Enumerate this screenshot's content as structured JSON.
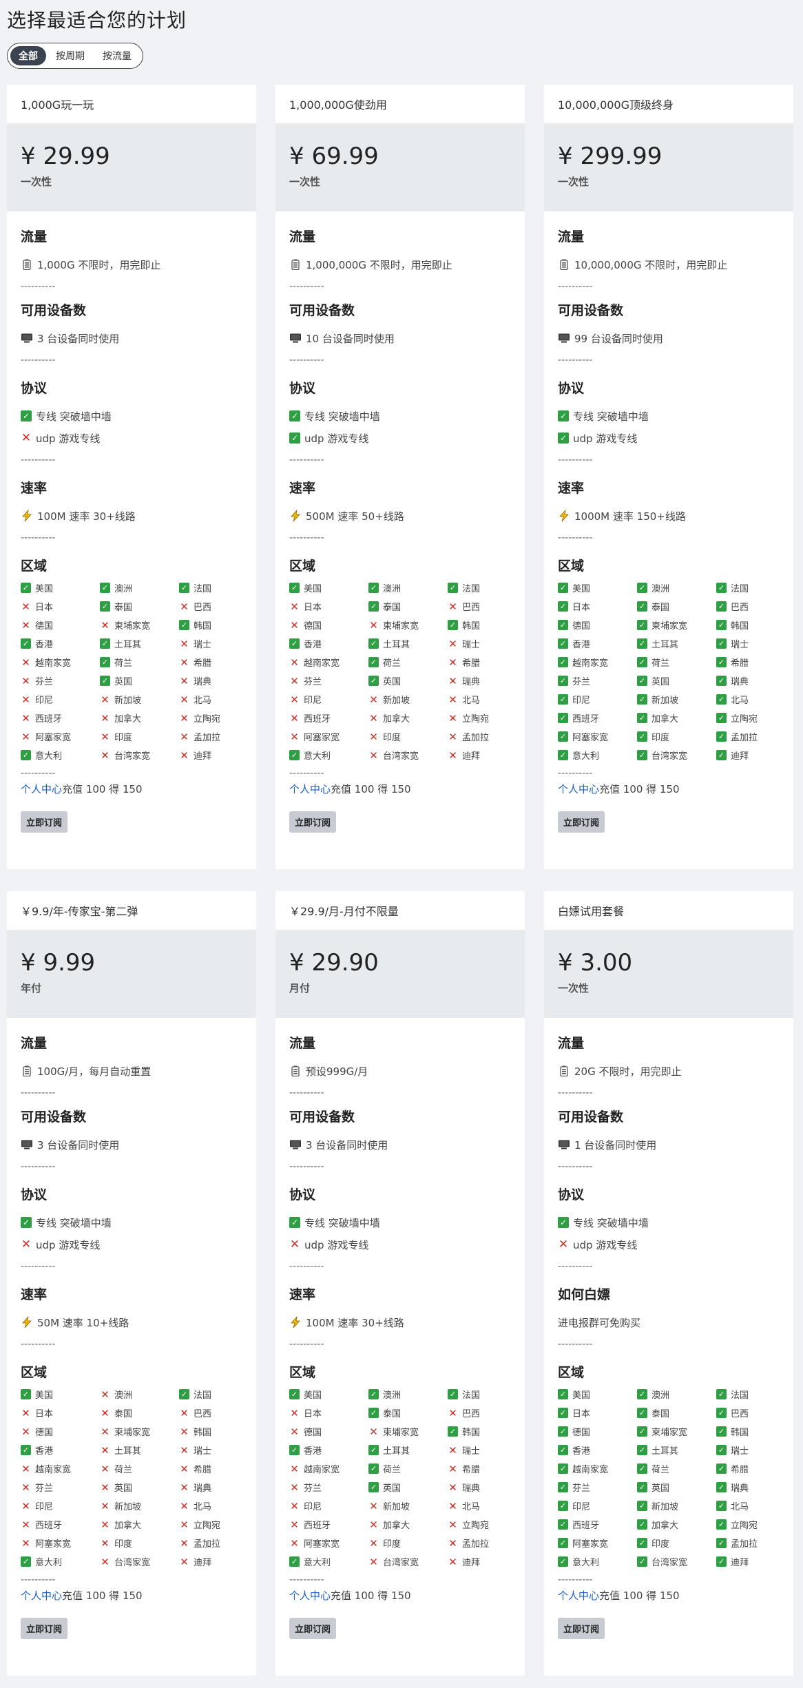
{
  "title": "选择最适合您的计划",
  "filters": [
    "全部",
    "按周期",
    "按流量"
  ],
  "active_filter": 0,
  "labels": {
    "traffic": "流量",
    "devices": "可用设备数",
    "protocol": "协议",
    "speed": "速率",
    "regions": "区域",
    "separator": "----------",
    "promo_link": "个人中心",
    "promo_text": "充值 100 得 150",
    "subscribe": "立即订阅",
    "proto_1": "专线 突破墙中墙",
    "proto_2": "udp 游戏专线"
  },
  "region_names": [
    "美国",
    "澳洲",
    "法国",
    "日本",
    "泰国",
    "巴西",
    "德国",
    "柬埔家宽",
    "韩国",
    "香港",
    "土耳其",
    "瑞士",
    "越南家宽",
    "荷兰",
    "希腊",
    "芬兰",
    "英国",
    "瑞典",
    "印尼",
    "新加坡",
    "北马",
    "西班牙",
    "加拿大",
    "立陶宛",
    "阿塞家宽",
    "印度",
    "孟加拉",
    "意大利",
    "台湾家宽",
    "迪拜"
  ],
  "plans": [
    {
      "name": "1,000G玩一玩",
      "price": "¥ 29.99",
      "period": "一次性",
      "traffic": "1,000G 不限时，用完即止",
      "devices": "3 台设备同时使用",
      "proto": [
        true,
        false
      ],
      "speed": "100M 速率 30+线路",
      "regions": [
        1,
        1,
        1,
        0,
        1,
        0,
        0,
        0,
        1,
        1,
        1,
        0,
        0,
        1,
        0,
        0,
        1,
        0,
        0,
        0,
        0,
        0,
        0,
        0,
        0,
        0,
        0,
        1,
        0,
        0
      ]
    },
    {
      "name": "1,000,000G使劲用",
      "price": "¥ 69.99",
      "period": "一次性",
      "traffic": "1,000,000G 不限时，用完即止",
      "devices": "10 台设备同时使用",
      "proto": [
        true,
        true
      ],
      "speed": "500M 速率 50+线路",
      "regions": [
        1,
        1,
        1,
        0,
        1,
        0,
        0,
        0,
        1,
        1,
        1,
        0,
        0,
        1,
        0,
        0,
        1,
        0,
        0,
        0,
        0,
        0,
        0,
        0,
        0,
        0,
        0,
        1,
        0,
        0
      ]
    },
    {
      "name": "10,000,000G顶级终身",
      "price": "¥ 299.99",
      "period": "一次性",
      "traffic": "10,000,000G 不限时，用完即止",
      "devices": "99 台设备同时使用",
      "proto": [
        true,
        true
      ],
      "speed": "1000M 速率 150+线路",
      "regions": [
        1,
        1,
        1,
        1,
        1,
        1,
        1,
        1,
        1,
        1,
        1,
        1,
        1,
        1,
        1,
        1,
        1,
        1,
        1,
        1,
        1,
        1,
        1,
        1,
        1,
        1,
        1,
        1,
        1,
        1
      ]
    },
    {
      "name": "￥9.9/年-传家宝-第二弹",
      "price": "¥ 9.99",
      "period": "年付",
      "traffic": "100G/月，每月自动重置",
      "devices": "3 台设备同时使用",
      "proto": [
        true,
        false
      ],
      "speed": "50M 速率 10+线路",
      "regions": [
        1,
        0,
        1,
        0,
        0,
        0,
        0,
        0,
        0,
        1,
        0,
        0,
        0,
        0,
        0,
        0,
        0,
        0,
        0,
        0,
        0,
        0,
        0,
        0,
        0,
        0,
        0,
        1,
        0,
        0
      ]
    },
    {
      "name": "￥29.9/月-月付不限量",
      "price": "¥ 29.90",
      "period": "月付",
      "traffic": "预设999G/月",
      "devices": "3 台设备同时使用",
      "proto": [
        true,
        false
      ],
      "speed": "100M 速率 30+线路",
      "regions": [
        1,
        1,
        1,
        0,
        1,
        0,
        0,
        0,
        1,
        1,
        1,
        0,
        0,
        1,
        0,
        0,
        1,
        0,
        0,
        0,
        0,
        0,
        0,
        0,
        0,
        0,
        0,
        1,
        0,
        0
      ]
    },
    {
      "name": "白嫖试用套餐",
      "price": "¥ 3.00",
      "period": "一次性",
      "traffic": "20G 不限时，用完即止",
      "devices": "1 台设备同时使用",
      "proto": [
        true,
        false
      ],
      "speed_title": "如何白嫖",
      "speed_plain": "进电报群可免购买",
      "regions": [
        1,
        1,
        1,
        1,
        1,
        1,
        1,
        1,
        1,
        1,
        1,
        1,
        1,
        1,
        1,
        1,
        1,
        1,
        1,
        1,
        1,
        1,
        1,
        1,
        1,
        1,
        1,
        1,
        1,
        1
      ]
    }
  ],
  "icons": {
    "traffic": "battery-icon",
    "devices": "monitor-icon",
    "speed": "lightning-icon",
    "ok": "check-icon",
    "no": "cross-icon"
  },
  "colors": {
    "ok": "#2ea043",
    "no": "#d03024",
    "link": "#1a5fd6",
    "active_filter": "#3b4250"
  }
}
